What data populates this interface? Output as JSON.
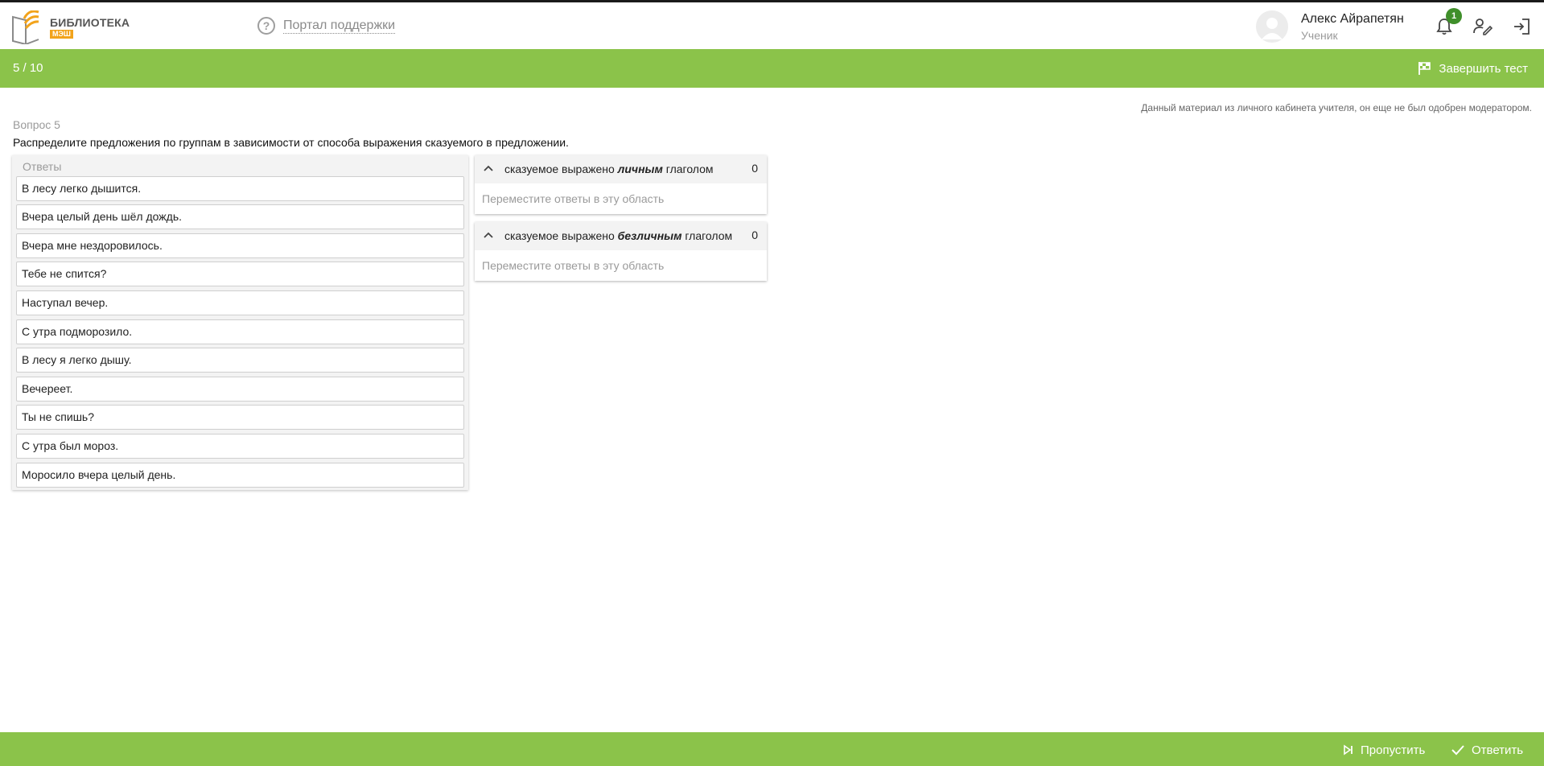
{
  "header": {
    "logo_title": "БИБЛИОТЕКА",
    "logo_sub": "МЭШ",
    "support_link": "Портал поддержки",
    "user": {
      "name": "Алекс Айрапетян",
      "role": "Ученик"
    },
    "notifications_count": "1",
    "icons": [
      "question-icon",
      "bell-icon",
      "edit-profile-icon",
      "logout-icon"
    ]
  },
  "topbar": {
    "progress": "5 / 10",
    "finish_label": "Завершить тест"
  },
  "notice": "Данный материал из личного кабинета учителя, он еще не был одобрен модератором.",
  "question": {
    "label": "Вопрос 5",
    "text": "Распределите предложения по группам в зависимости от способа выражения сказуемого в предложении."
  },
  "answers": {
    "title": "Ответы",
    "items": [
      "В лесу легко дышится.",
      "Вчера целый день шёл дождь.",
      "Вчера мне нездоровилось.",
      "Тебе не спится?",
      "Наступал вечер.",
      "С утра подморозило.",
      "В лесу я легко дышу.",
      "Вечереет.",
      "Ты не спишь?",
      "С утра был мороз.",
      "Моросило вчера целый день."
    ]
  },
  "groups": [
    {
      "title_prefix": "сказуемое выражено ",
      "title_emph": "личным",
      "title_suffix": " глаголом",
      "count": "0",
      "placeholder": "Переместите ответы в эту область"
    },
    {
      "title_prefix": "сказуемое выражено ",
      "title_emph": "безличным",
      "title_suffix": " глаголом",
      "count": "0",
      "placeholder": "Переместите ответы в эту область"
    }
  ],
  "footer": {
    "skip_label": "Пропустить",
    "answer_label": "Ответить"
  },
  "colors": {
    "accent_green": "#8bc34a",
    "badge_green": "#3f8f2a",
    "logo_orange": "#f2a31b"
  }
}
